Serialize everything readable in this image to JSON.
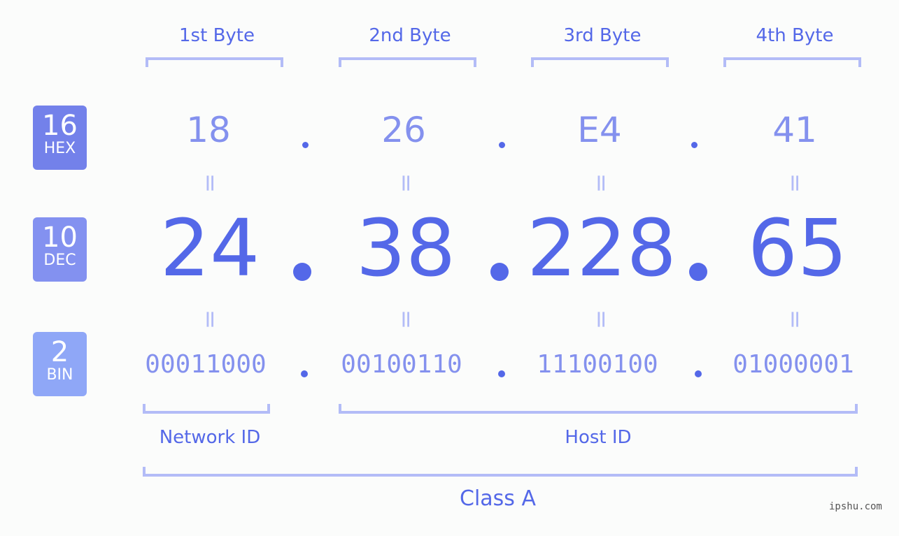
{
  "bytes": [
    {
      "label": "1st Byte",
      "hex": "18",
      "dec": "24",
      "bin": "00011000"
    },
    {
      "label": "2nd Byte",
      "hex": "26",
      "dec": "38",
      "bin": "00100110"
    },
    {
      "label": "3rd Byte",
      "hex": "E4",
      "dec": "228",
      "bin": "11100100"
    },
    {
      "label": "4th Byte",
      "hex": "41",
      "dec": "65",
      "bin": "01000001"
    }
  ],
  "badges": {
    "hex": {
      "num": "16",
      "label": "HEX",
      "color": "#7381ea"
    },
    "dec": {
      "num": "10",
      "label": "DEC",
      "color": "#8391f0"
    },
    "bin": {
      "num": "2",
      "label": "BIN",
      "color": "#8fa7f7"
    }
  },
  "equals": "=",
  "network_id_label": "Network ID",
  "host_id_label": "Host ID",
  "class_label": "Class A",
  "watermark": "ipshu.com",
  "colors": {
    "accent": "#5468e8",
    "light": "#8491ee",
    "bracket": "#b3bcf7"
  }
}
